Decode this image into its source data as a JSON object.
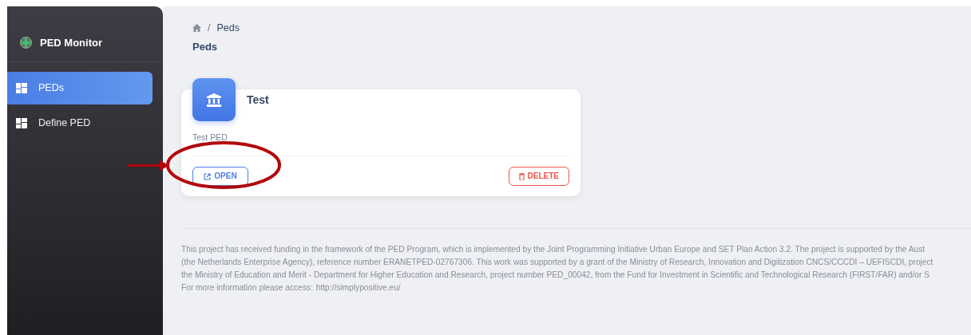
{
  "sidebar": {
    "brand": "PED Monitor",
    "items": [
      {
        "label": "PEDs",
        "selected": true
      },
      {
        "label": "Define PED",
        "selected": false
      }
    ]
  },
  "breadcrumb": {
    "separator": "/",
    "items": [
      "Peds"
    ],
    "title": "Peds"
  },
  "cards": [
    {
      "title": "Test",
      "description": "Test PED",
      "buttons": [
        {
          "label": "OPEN",
          "kind": "open"
        },
        {
          "label": "DELETE",
          "kind": "delete"
        }
      ]
    }
  ],
  "footer": {
    "lines": [
      "This project has received funding in the framework of the PED Program, which is implemented by the Joint Programming Initiative Urban Europe and SET Plan Action 3.2. The project is supported by the Aust",
      "(the Netherlands Enterprise Agency), reference number ERANETPED-02767306. This work was supported by a grant of the Ministry of Research, Innovation and Digitization CNCS/CCCDI – UEFISCDI, project",
      "the Ministry of Education and Merit - Department for Higher Education and Research, project number PED_00042, from the Fund for Investment in Scientific and Technological Research (FIRST/FAR) and/or S"
    ],
    "info": "For more information please access:",
    "link": "http://simplypositive.eu/"
  }
}
